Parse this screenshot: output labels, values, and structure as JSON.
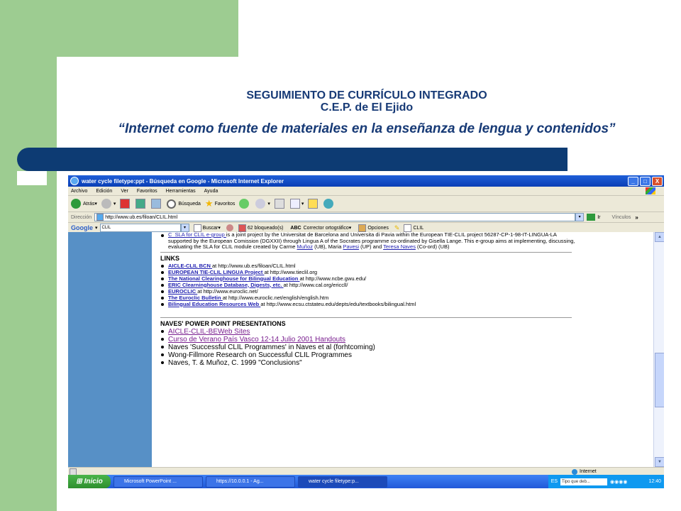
{
  "slide": {
    "title_line1": "SEGUIMIENTO DE CURRÍCULO INTEGRADO",
    "title_line2": "C.E.P. de El Ejido",
    "subtitle": "“Internet como fuente de materiales en la enseñanza de lengua y contenidos”"
  },
  "browser": {
    "title": "water cycle filetype:ppt - Búsqueda en Google - Microsoft Internet Explorer",
    "window_buttons": {
      "minimize": "_",
      "maximize": "□",
      "close": "X"
    },
    "menu": [
      "Archivo",
      "Edición",
      "Ver",
      "Favoritos",
      "Herramientas",
      "Ayuda"
    ],
    "toolbar": {
      "back": "Atrás",
      "search": "Búsqueda",
      "favorites": "Favoritos"
    },
    "address_label": "Dirección",
    "address_value": "http://www.ub.es/filoan/CLIL.html",
    "go_label": "Ir",
    "links_label": "Vínculos",
    "links_chevron": "»",
    "google": {
      "logo": "Google",
      "query": "CLIL",
      "search_label": "Buscar",
      "blocked": "62 bloqueado(s)",
      "spell": "Corrector ortográfico",
      "options": "Opciones",
      "clil": "CLIL"
    },
    "status": "Internet"
  },
  "page": {
    "intro_link": "C_SLA for CLIL e-group ",
    "intro_text": "is a joint project by the Universitat de Barcelona and Universita di Pavia within the  European TIE-CLIL project 56287-CP-1-98-IT-LINGUA-LA supported by the European Comission (DGXXII) through Lingua A of the Socrates programme co-ordinated by Gisella Lange. This e-group aims at implementing, discussing, evaluating the SLA for CLIL module created by Carme ",
    "intro_n1": " Muñoz",
    "intro_t1": " (UB), Maria ",
    "intro_n2": "Pavesi",
    "intro_t2": " (UP) and ",
    "intro_n3": "Teresa Naves",
    "intro_t3": "  (Co-ord) (UB)",
    "links_heading": "LINKS",
    "links": [
      {
        "name": "AICLE-CLIL BCN ",
        "url": " at http://www.ub.es/filoan/CLIL.html"
      },
      {
        "name": "EUROPEAN TIE-CLIL LINGUA Project ",
        "url": "at http://www.tieclil.org"
      },
      {
        "name": "The National Clearinghouse for Bilingual Education ",
        "url": "at http://www.ncbe.gwu.edu/"
      },
      {
        "name": "ERIC Clearninghouse Database, Digests, etc. ",
        "url": "at http://www.cal.org/ericcll/"
      },
      {
        "name": "EUROCLIC ",
        "url": "at http://www.euroclic.net/"
      },
      {
        "name": "The Euroclic Bulletin ",
        "url": "at http://www.euroclic.net/english/english.htm"
      },
      {
        "name": "Bilingual Education Resources Web ",
        "url": "at http://www.ecsu.ctstateu.edu/depts/edu/textbooks/bilingual.html"
      }
    ],
    "ppt_heading": "NAVES' POWER POINT PRESENTATIONS",
    "ppt": [
      "AICLE-CLIL-BEWeb Sites",
      "Curso de Verano País Vasco 12-14 Julio 2001 Handouts",
      "Naves 'Successful CLIL Programmes' in Naves et al (forhtcoming)",
      "Wong-Fillmore Research on Successful CLIL Programmes",
      "Naves, T. & Muñoz, C. 1999 \"Conclusions\""
    ]
  },
  "taskbar": {
    "start": "Inicio",
    "tasks": [
      "Microsoft PowerPoint ...",
      "https://10.0.0.1 - Ag...",
      "water cycle filetype:p..."
    ],
    "lang": "ES",
    "search_placeholder": "Tipo que deb...",
    "clock": "12:40"
  }
}
